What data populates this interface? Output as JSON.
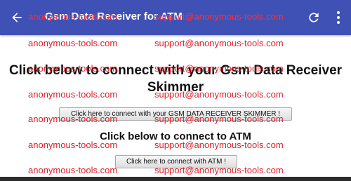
{
  "appbar": {
    "title": "Gsm Data Receiver for ATM",
    "back_icon": "arrow-back-icon",
    "refresh_icon": "refresh-icon",
    "more_icon": "more-vert-icon",
    "color": "#3f51b5"
  },
  "main": {
    "heading": "Click below to connect with your Gsm Data Receiver Skimmer",
    "gsm_button_label": "Click here to connect with your GSM DATA RECEIVER SKIMMER !",
    "atm_heading": "Click below to connect to ATM",
    "atm_button_label": "Click here to connect with ATM !"
  },
  "watermark": {
    "site": "anonymous-tools.com",
    "email": "support@anonymous-tools.com",
    "color": "#e0202a"
  }
}
